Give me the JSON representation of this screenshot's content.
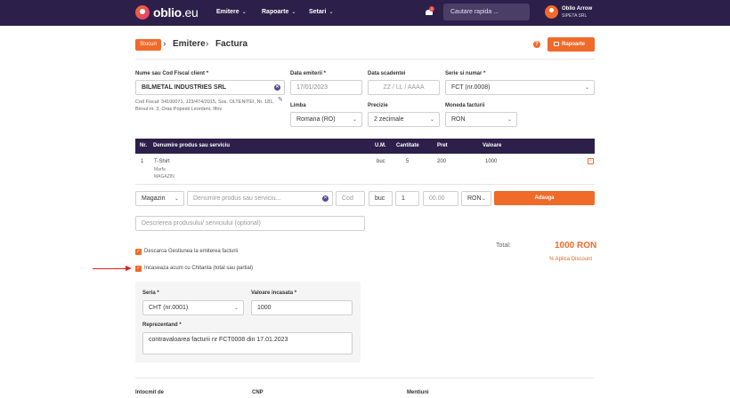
{
  "app": {
    "logo_text": "oblio",
    "logo_suffix": ".eu"
  },
  "nav": [
    {
      "label": "Emitere"
    },
    {
      "label": "Rapoarte"
    },
    {
      "label": "Setari"
    }
  ],
  "notifications": {
    "count": "1"
  },
  "search": {
    "placeholder": "Cautare rapida ..."
  },
  "user": {
    "name": "Oblio Arrow",
    "company": "SIPETA SRL"
  },
  "breadcrumb": {
    "badge": "Stocuri",
    "sep": "›",
    "level1": "Emitere",
    "level2": "Factura"
  },
  "header": {
    "help": "?",
    "reports_button": "Rapoarte"
  },
  "client": {
    "label": "Nume sau Cod Fiscal client *",
    "value": "BILMETAL INDUSTRIES SRL",
    "details": "Cod Fiscal: 34100071, J23/474/2015, Sos. OLTENITEI, Nr. 181, Biroul nr. 3, Oras Popesti Leordeni, Ilfov"
  },
  "dates": {
    "issue_label": "Data emiterii *",
    "issue_value": "17/01/2023",
    "due_label": "Data scadentei",
    "due_placeholder": "ZZ / LL / AAAA"
  },
  "series": {
    "label": "Serie si numar *",
    "value": "FCT (nr.0008)"
  },
  "language": {
    "label": "Limba",
    "value": "Romana (RO)"
  },
  "precision": {
    "label": "Precizie",
    "value": "2 zecimale"
  },
  "currency": {
    "label": "Moneda facturii",
    "value": "RON"
  },
  "table": {
    "headers": [
      "Nr.",
      "Denumire produs sau serviciu",
      "U.M.",
      "Cantitate",
      "Pret",
      "Valoare"
    ],
    "rows": [
      {
        "nr": "1",
        "name": "T-Shirt",
        "sub1": "Marfa",
        "sub2": "MAGAZIN",
        "um": "buc",
        "qty": "5",
        "price": "200",
        "value": "1000"
      }
    ]
  },
  "add_row": {
    "warehouse": "Magazin",
    "product_placeholder": "Denumire produs sau serviciu...",
    "code_placeholder": "Cod",
    "um": "buc",
    "qty": "1",
    "price_placeholder": "00.00",
    "currency": "RON",
    "add_button": "Adauga",
    "description_placeholder": "Descrierea produsului/ serviciului (optional)"
  },
  "options": {
    "stock_checkbox": "Descarca Gestiunea la emiterea facturii",
    "receipt_checkbox": "Incaseaza acum cu Chitanta (total sau partial)"
  },
  "totals": {
    "label": "Total:",
    "value": "1000 RON",
    "discount_link": "% Aplica Discount"
  },
  "receipt": {
    "series_label": "Seria *",
    "series_value": "CHT (nr.0001)",
    "amount_label": "Valoare incasata *",
    "amount_value": "1000",
    "representative_label": "Reprezentand *",
    "representative_value": "contravaloarea facturii nr FCT0008 din 17.01.2023"
  },
  "footer": {
    "issued_by": "Intocmit de",
    "cnp": "CNP",
    "mentions": "Mentiuni"
  },
  "colors": {
    "topbar": "#2c1f4a",
    "accent": "#f06a2a",
    "table_header": "#2c1f4a",
    "arrow": "#e02020"
  }
}
